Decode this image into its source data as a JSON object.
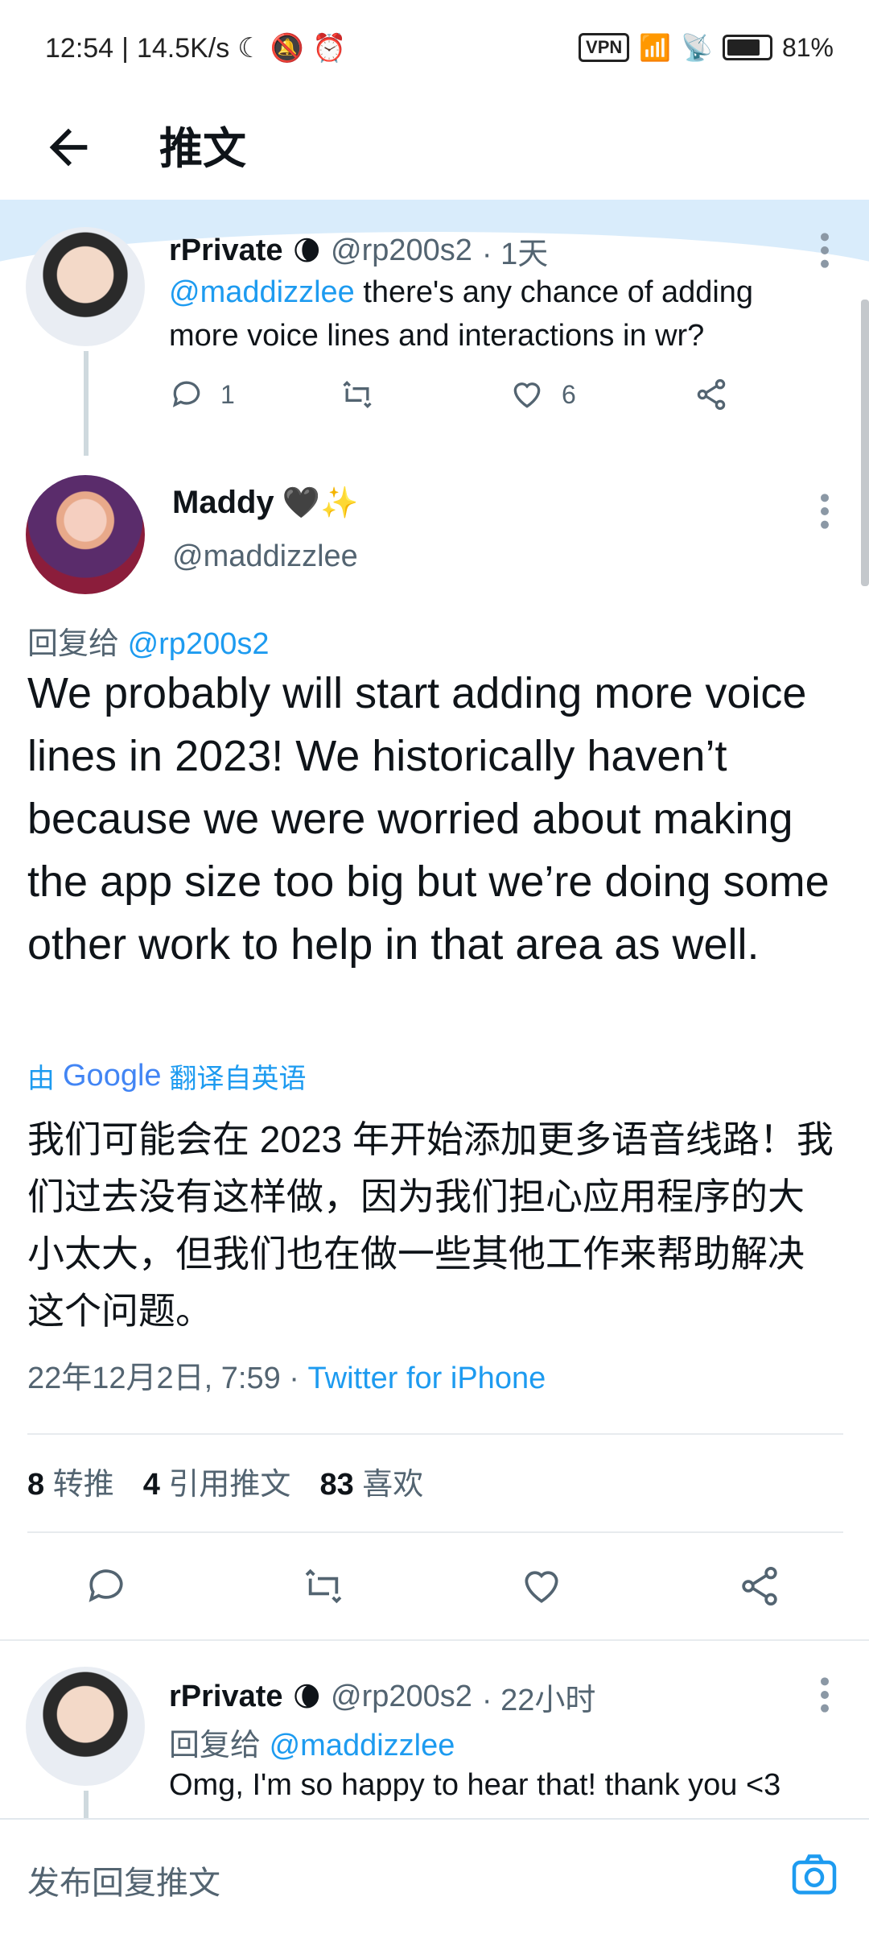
{
  "status_bar": {
    "time": "12:54",
    "speed": "14.5K/s",
    "vpn": "VPN",
    "battery": "81%"
  },
  "header": {
    "title": "推文"
  },
  "parent_tweet": {
    "name": "rPrivate",
    "name_emoji": "🌘",
    "handle": "@rp200s2",
    "time": "· 1天",
    "mention": "@maddizzlee",
    "text_rest": " there's any chance of adding more voice lines and interactions in wr?",
    "reply_count": "1",
    "like_count": "6"
  },
  "main_tweet": {
    "name": "Maddy",
    "name_emoji": "🖤✨",
    "handle": "@maddizzlee",
    "reply_to_label": "回复给",
    "reply_to_handle": "@rp200s2",
    "text": "We probably will start adding more voice lines in 2023! We historically haven’t because we were worried about making the app size too big but we’re doing some other work to help in that area as well.",
    "translated_by_prefix": "由",
    "translated_by_brand": "Google",
    "translated_by_suffix": "翻译自英语",
    "translation": "我们可能会在 2023 年开始添加更多语音线路！我们过去没有这样做，因为我们担心应用程序的大小太大，但我们也在做一些其他工作来帮助解决这个问题。",
    "timestamp": "22年12月2日, 7:59 ·",
    "source": "Twitter for iPhone",
    "retweets_count": "8",
    "retweets_label": "转推",
    "quotes_count": "4",
    "quotes_label": "引用推文",
    "likes_count": "83",
    "likes_label": "喜欢"
  },
  "reply_tweet": {
    "name": "rPrivate",
    "name_emoji": "🌘",
    "handle": "@rp200s2",
    "time": "· 22小时",
    "reply_to_label": "回复给",
    "reply_to_handle": "@maddizzlee",
    "text": "Omg, I'm so happy to hear that! thank you <3"
  },
  "compose": {
    "placeholder": "发布回复推文"
  },
  "colors": {
    "link": "#1d9bf0",
    "muted": "#536471",
    "highlight": "#d9ecfb"
  }
}
